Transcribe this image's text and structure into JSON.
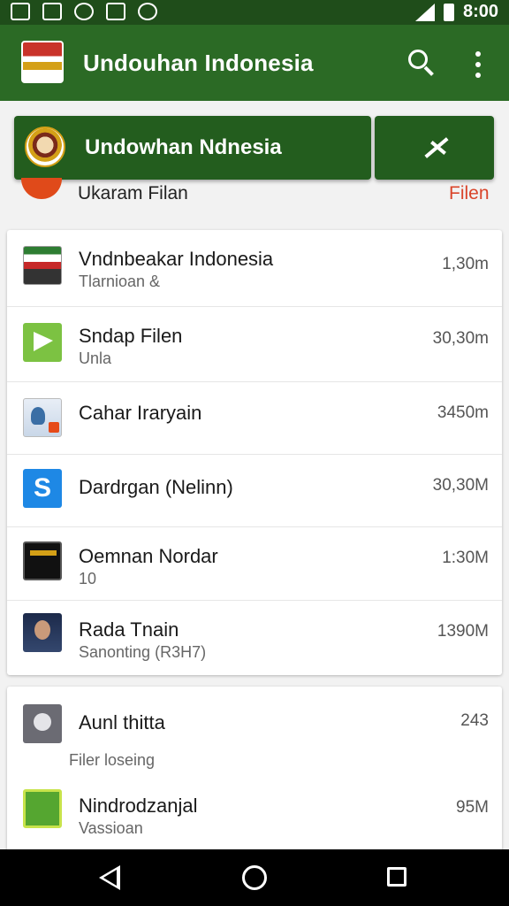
{
  "statusbar": {
    "time": "8:00"
  },
  "appbar": {
    "title": "Undouhan Indonesia"
  },
  "banner": {
    "title": "Undowhan Ndnesia"
  },
  "peek": {
    "name": "Ukaram Filan",
    "tag": "Filen"
  },
  "list": [
    {
      "title": "Vndnbeakar Indonesia",
      "subtitle": "Tlarnioan &",
      "size": "1,30m",
      "icon": "flag-app-icon"
    },
    {
      "title": "Sndap Filen",
      "subtitle": "Unla",
      "size": "30,30m",
      "icon": "play-icon"
    },
    {
      "title": "Cahar Iraryain",
      "subtitle": "",
      "size": "3450m",
      "icon": "id-card-icon"
    },
    {
      "title": "Dardrgan (Nelinn)",
      "subtitle": "",
      "size": "30,30M",
      "icon": "s-app-icon"
    },
    {
      "title": "Oemnan Nordar",
      "subtitle": "10",
      "size": "1:30M",
      "icon": "dark-app-icon"
    },
    {
      "title": "Rada Tnain",
      "subtitle": "Sanonting (R3H7)",
      "size": "1390M",
      "icon": "portrait-icon"
    }
  ],
  "list2": [
    {
      "title": "Aunl thitta",
      "subtitle": "Filer loseing",
      "size": "243",
      "icon": "toggle-app-icon"
    },
    {
      "title": "Nindrodzanjal",
      "subtitle": "Vassioan",
      "size": "95M",
      "icon": "green-badge-icon"
    }
  ],
  "colors": {
    "appbar": "#2b6a25",
    "statusbar": "#1f4d1a",
    "accent": "#d9442a"
  }
}
